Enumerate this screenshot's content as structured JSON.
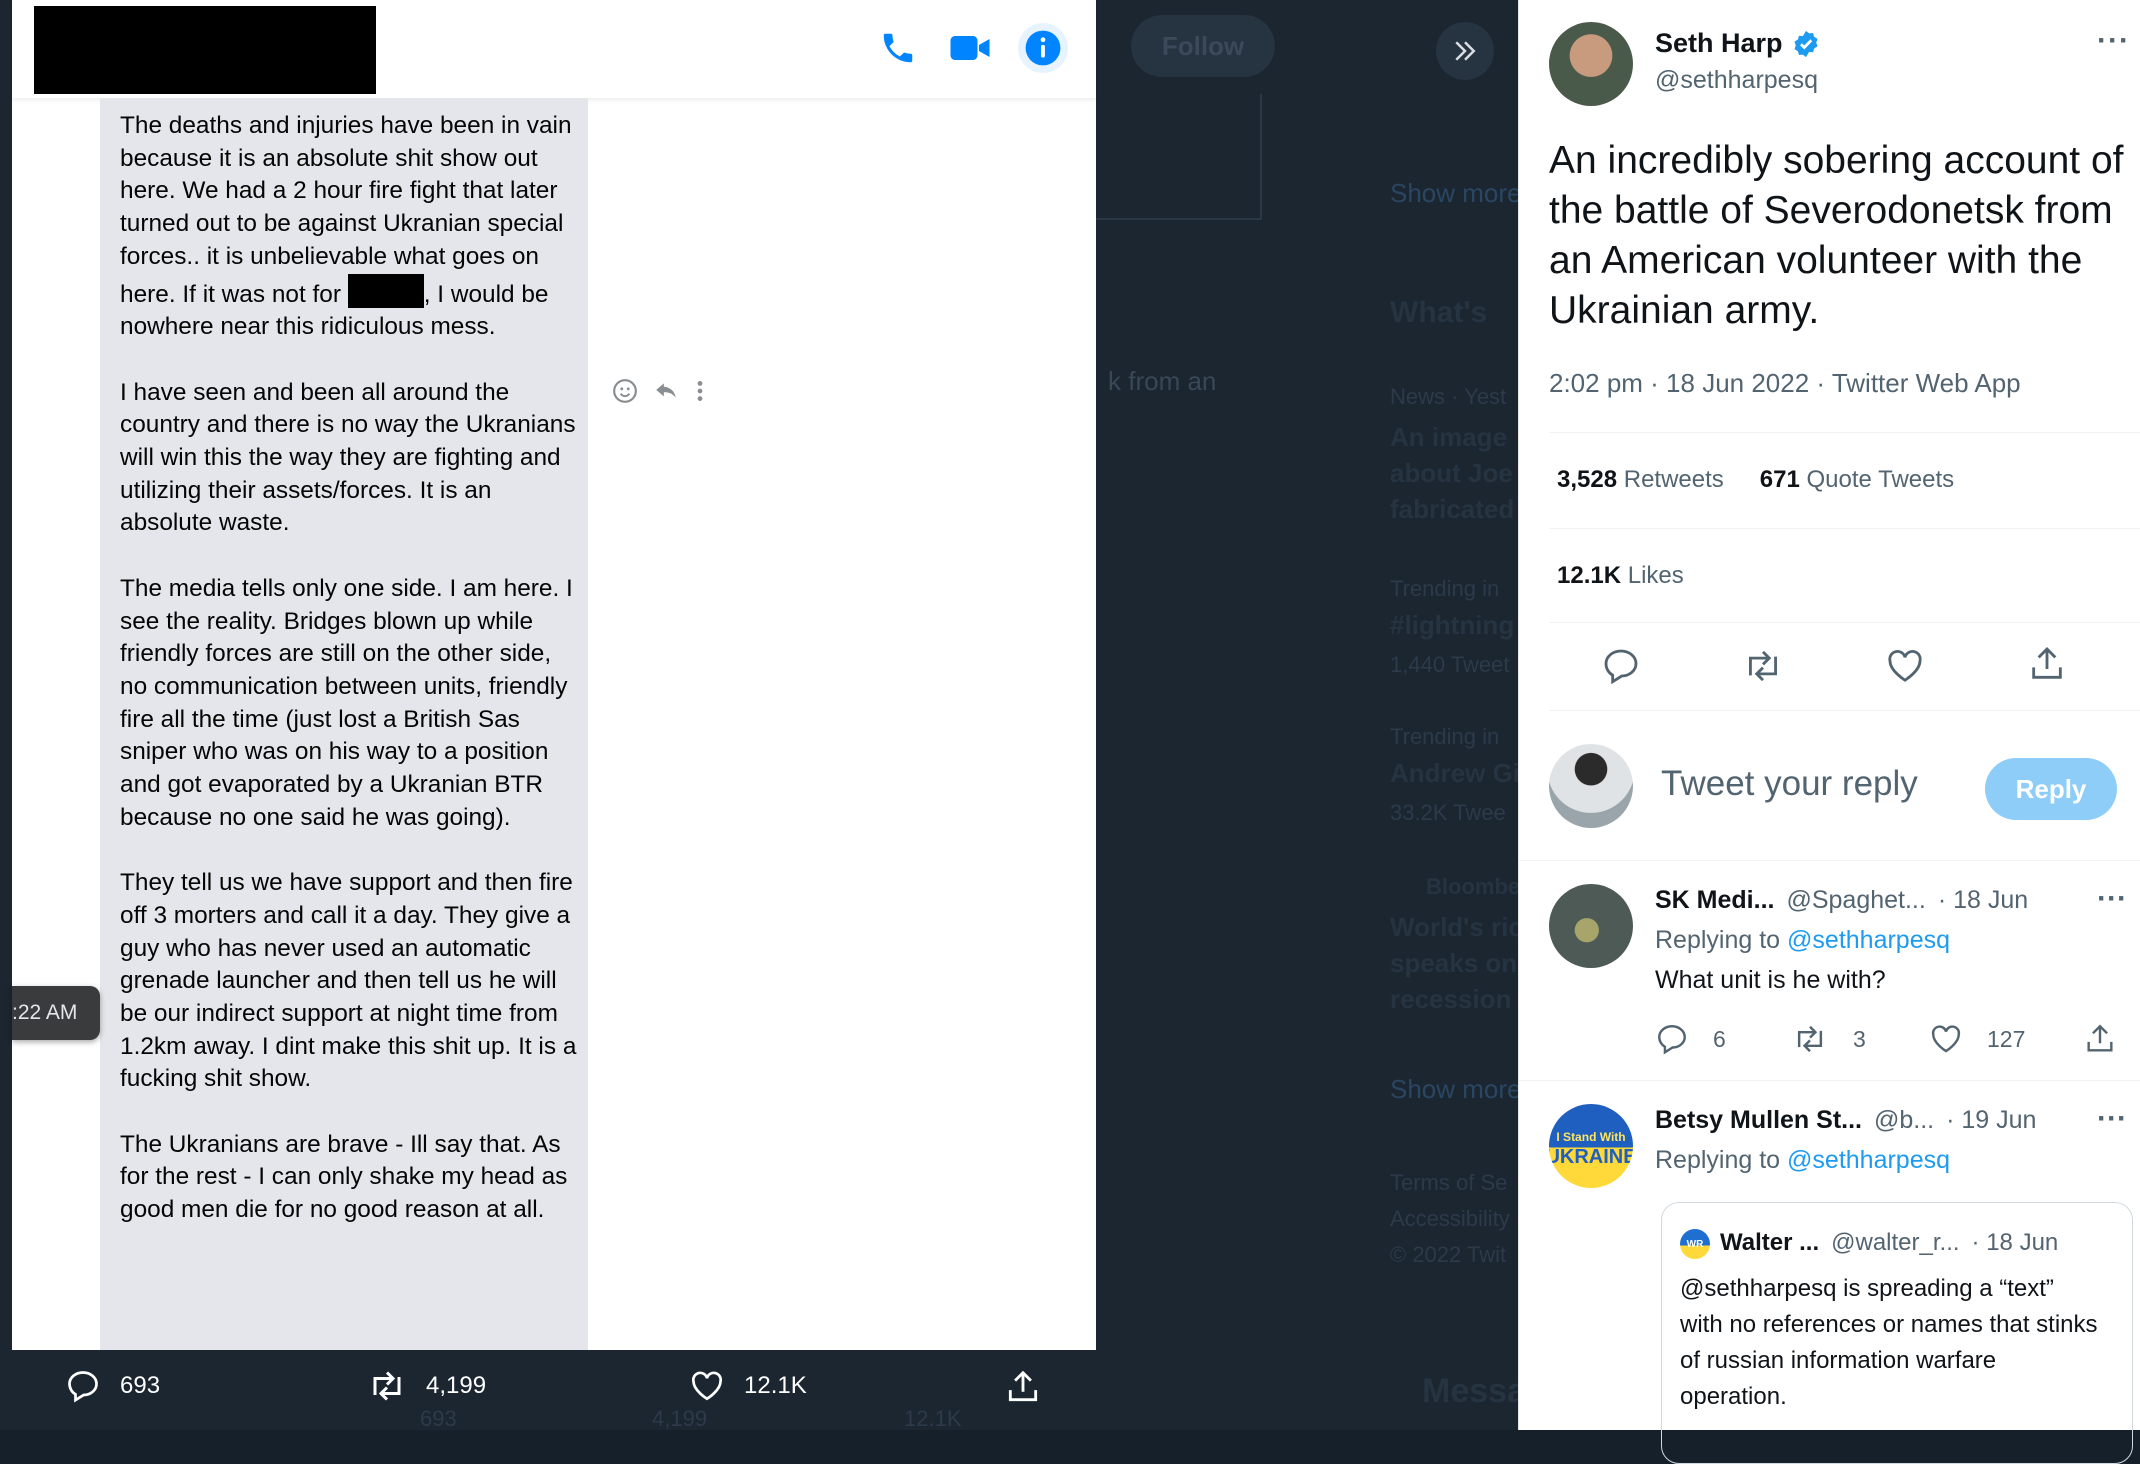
{
  "screenshot_stats": {
    "replies": "693",
    "retweets": "4,199",
    "likes": "12.1K"
  },
  "messenger": {
    "time_label": ":22 AM",
    "paragraphs": [
      {
        "before": "The deaths and injuries have been in vain because it is an absolute shit show out here. We had a 2 hour fire fight that later turned out to be against Ukranian special forces.. it is unbelievable what goes on here. If it was not for ",
        "after": ", I would be nowhere near this ridiculous mess."
      },
      {
        "text": "I have seen and been all around the country and there is no way the Ukranians will win this the way they are fighting and utilizing their assets/forces. It is an absolute waste."
      },
      {
        "text": "The media tells only one side. I am here. I see the reality. Bridges blown up while friendly forces are still on the other side, no communication between units, friendly fire all the time (just lost a British Sas sniper who was on his way to a position and got evaporated by a Ukranian BTR because no one said he was going)."
      },
      {
        "text": "They tell us we have support and then fire off 3 morters and call it a day. They give a guy who has never used an automatic grenade launcher and then tell us he will be our indirect support at night time from 1.2km away. I dint make this shit up. It is a fucking shit show."
      },
      {
        "text": "The Ukranians are brave - Ill say that. As for the rest - I can only shake my head as good men die for no good reason at all."
      }
    ]
  },
  "background": {
    "follow_label": "Follow",
    "show_more": "Show more",
    "whats_happening": "What's",
    "news_meta": "News · Yest",
    "news_headline": [
      "An image",
      "about Joe",
      "fabricated"
    ],
    "trend1_meta": "Trending in",
    "trend1_tag": "#lightning",
    "trend1_count": "1,440 Tweet",
    "trend2_meta": "Trending in",
    "trend2_tag": "Andrew Gi",
    "trend2_count": "33.2K Twee",
    "bloomberg": "Bloomberg",
    "bloomberg_lines": [
      "World's ric",
      "speaks on",
      "recession"
    ],
    "snippet": "k from an",
    "footer": [
      "Terms of Se",
      "Accessibility",
      "© 2022 Twit"
    ],
    "messages": "Messa",
    "ghost_stats": [
      "693",
      "4,199",
      "12.1K"
    ]
  },
  "tweet": {
    "author_name": "Seth Harp",
    "author_handle": "@sethharpesq",
    "text": "An incredibly sobering account of the battle of Severodonetsk from an American volunteer with the Ukrainian army.",
    "meta": "2:02 pm · 18 Jun 2022 · Twitter Web App",
    "retweets_count": "3,528",
    "retweets_label": "Retweets",
    "quotes_count": "671",
    "quotes_label": "Quote Tweets",
    "likes_count": "12.1K",
    "likes_label": "Likes",
    "more": "···"
  },
  "reply_box": {
    "placeholder": "Tweet your reply",
    "button": "Reply"
  },
  "replies": [
    {
      "name": "SK Medi...",
      "handle": "@Spaghet...",
      "date": "· 18 Jun",
      "replying_prefix": "Replying to",
      "replying_to": "@sethharpesq",
      "text": "What unit is he with?",
      "reply_count": "6",
      "retweet_count": "3",
      "like_count": "127"
    },
    {
      "name": "Betsy Mullen St...",
      "handle": "@b...",
      "date": "· 19 Jun",
      "replying_prefix": "Replying to",
      "replying_to": "@sethharpesq",
      "avatar_top": "I Stand With",
      "avatar_bottom": "UKRAINE",
      "quoted": {
        "name": "Walter ...",
        "handle": "@walter_r...",
        "date": "· 18 Jun",
        "avatar_text": "WR",
        "text": "@sethharpesq is spreading a “text” with no references or names that stinks of russian information warfare operation."
      }
    }
  ],
  "colors": {
    "accent": "#1d9bf0",
    "messenger_blue": "#0084ff",
    "reply_button_disabled": "#8ecdf8"
  }
}
